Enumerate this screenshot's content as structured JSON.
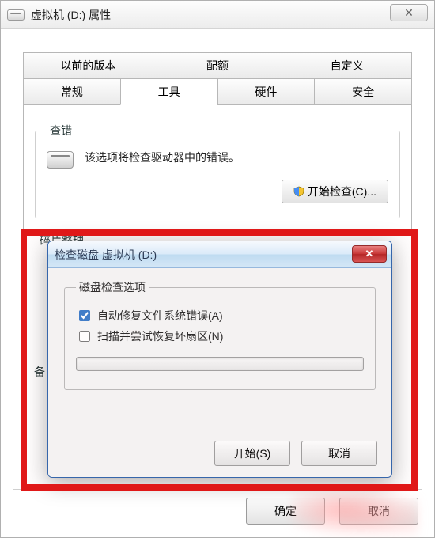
{
  "window": {
    "title": "虚拟机 (D:) 属性",
    "close_glyph": "✕"
  },
  "tabs": {
    "row1": [
      "以前的版本",
      "配额",
      "自定义"
    ],
    "row2": [
      "常规",
      "工具",
      "硬件",
      "安全"
    ],
    "active": "工具"
  },
  "check_errors": {
    "legend": "查错",
    "text": "该选项将检查驱动器中的错误。",
    "button": "开始检查(C)..."
  },
  "defrag": {
    "legend": "碎片整理"
  },
  "backup_stub": {
    "legend": "备"
  },
  "footer": {
    "ok": "确定",
    "cancel": "取消"
  },
  "dialog": {
    "title": "检查磁盘 虚拟机 (D:)",
    "close_glyph": "✕",
    "options_legend": "磁盘检查选项",
    "opt1": {
      "label": "自动修复文件系统错误(A)",
      "checked": true
    },
    "opt2": {
      "label": "扫描并尝试恢复坏扇区(N)",
      "checked": false
    },
    "start": "开始(S)",
    "cancel": "取消"
  }
}
